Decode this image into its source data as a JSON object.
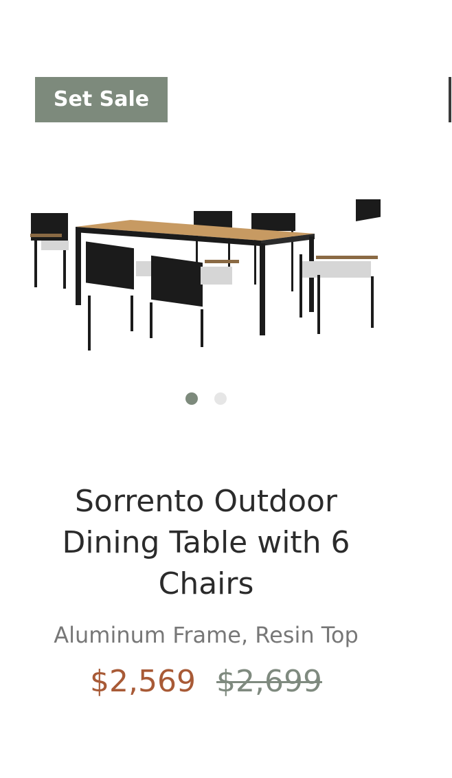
{
  "badge": {
    "label": "Set Sale"
  },
  "carousel": {
    "slide_count": 2,
    "active_index": 0
  },
  "product": {
    "title": "Sorrento Outdoor Dining Table with 6 Chairs",
    "subtitle": "Aluminum Frame, Resin Top",
    "sale_price": "$2,569",
    "original_price": "$2,699"
  },
  "colors": {
    "accent": "#7d8a7c",
    "sale_price": "#a85a36",
    "original_price": "#7f8a7f",
    "text": "#2b2b2b",
    "muted": "#777777"
  }
}
